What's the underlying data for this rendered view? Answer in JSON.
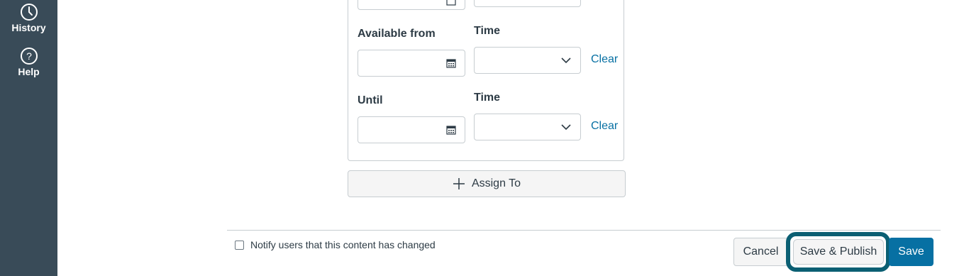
{
  "sidebar": {
    "items": [
      {
        "label": "History",
        "icon": "clock-icon"
      },
      {
        "label": "Help",
        "icon": "question-circle-icon"
      }
    ]
  },
  "assign": {
    "available_from_label": "Available from",
    "available_time_label": "Time",
    "available_from_value": "",
    "available_time_value": "",
    "until_label": "Until",
    "until_time_label": "Time",
    "until_value": "",
    "until_time_value": "",
    "clear_label": "Clear",
    "assign_to_label": "Assign To"
  },
  "footer": {
    "notify_label": "Notify users that this content has changed",
    "notify_checked": false,
    "cancel_label": "Cancel",
    "save_publish_label": "Save & Publish",
    "save_label": "Save"
  },
  "colors": {
    "sidebar_bg": "#394b58",
    "link": "#0770a3",
    "primary_button": "#0770a3",
    "focus_ring": "#0b5f73"
  }
}
